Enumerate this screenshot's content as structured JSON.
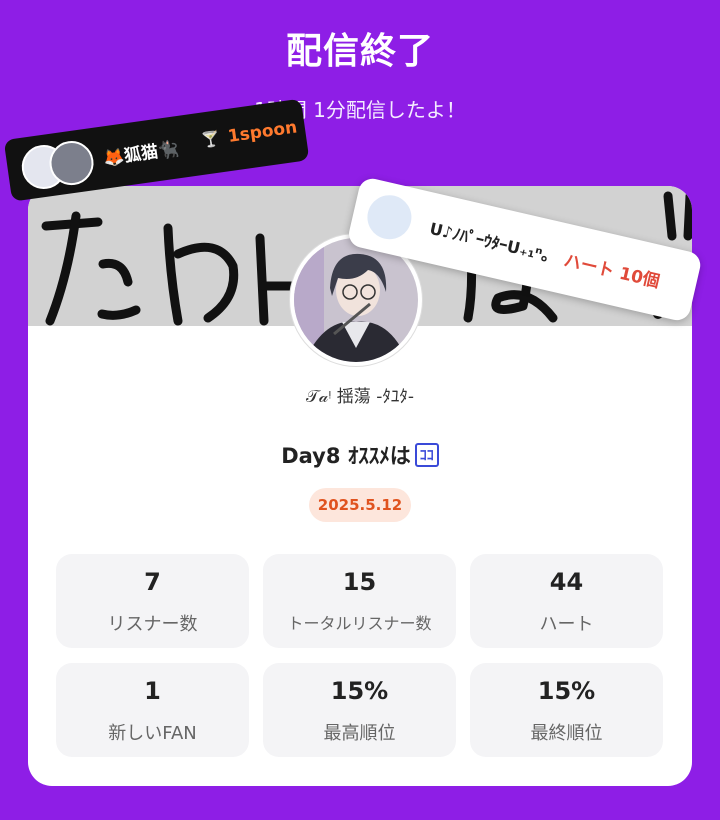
{
  "header": {
    "title": "配信終了",
    "subtitle": "1時間 1分配信したよ！"
  },
  "profile": {
    "dj_name": "𝒯𝒶ᵎ 揺蕩 -ﾀﾕﾀ-",
    "live_title": "Day8 ｵｽｽﾒは",
    "live_title_badge": "ｺｺ",
    "date": "2025.5.12"
  },
  "stats": [
    {
      "value": "7",
      "label": "リスナー数"
    },
    {
      "value": "15",
      "label": "トータルリスナー数"
    },
    {
      "value": "44",
      "label": "ハート"
    },
    {
      "value": "1",
      "label": "新しいFAN"
    },
    {
      "value": "15%",
      "label": "最高順位"
    },
    {
      "value": "15%",
      "label": "最終順位"
    }
  ],
  "stickers": {
    "left": {
      "name": "🦊狐猫🐈‍⬛",
      "spoon": "1spoon"
    },
    "right": {
      "name": "ᑌ♪ﾉﾊﾟｰｳﾀｰᑌ₊₁ⁿ｡",
      "heart": "ハート 10個"
    }
  },
  "colors": {
    "background": "#8e1ee6",
    "accent_orange": "#e0531f",
    "heart_red": "#e04a3a"
  }
}
